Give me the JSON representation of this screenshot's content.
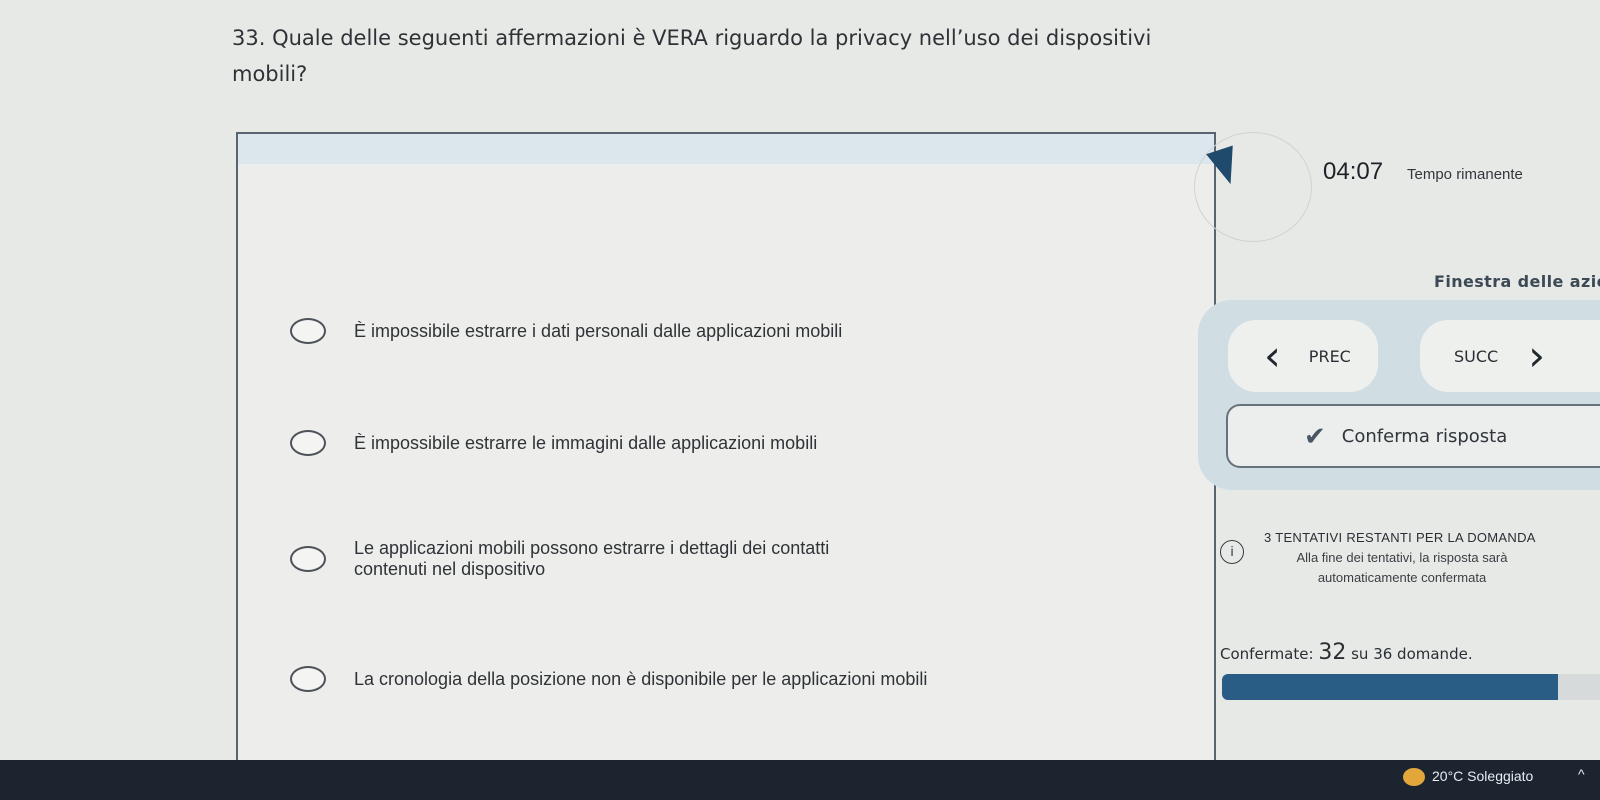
{
  "question": {
    "text": "33. Quale delle seguenti affermazioni è VERA riguardo la privacy nell’uso dei dispositivi mobili?"
  },
  "options": [
    {
      "label": "È impossibile estrarre i dati personali dalle applicazioni mobili"
    },
    {
      "label": "È impossibile estrarre le immagini dalle applicazioni mobili"
    },
    {
      "label": "Le applicazioni mobili possono estrarre i dettagli dei contatti contenuti nel dispositivo"
    },
    {
      "label": "La cronologia della posizione non è disponibile per le applicazioni mobili"
    }
  ],
  "timer": {
    "value": "04:07",
    "label": "Tempo rimanente"
  },
  "actions": {
    "title": "Finestra delle azioni",
    "prev_label": "PREC",
    "next_label": "SUCC",
    "confirm_label": "Conferma risposta",
    "prev_icon": "chevron-left-icon",
    "next_icon": "chevron-right-icon",
    "confirm_icon": "check-icon"
  },
  "attempts": {
    "title": "3 TENTATIVI RESTANTI PER LA DOMANDA",
    "note": "Alla fine dei tentativi, la risposta sarà automaticamente confermata",
    "icon": "info-icon"
  },
  "progress": {
    "prefix": "Confermate:",
    "count": "32",
    "suffix": "su 36 domande.",
    "fraction": 0.89
  },
  "taskbar": {
    "weather": "20°C  Soleggiato",
    "weather_icon": "sun-cloud-icon",
    "tray_icon": "chevron-up-icon"
  },
  "colors": {
    "accent": "#2a5d86",
    "panel": "#d0dde2",
    "background": "#e7e9e7"
  }
}
